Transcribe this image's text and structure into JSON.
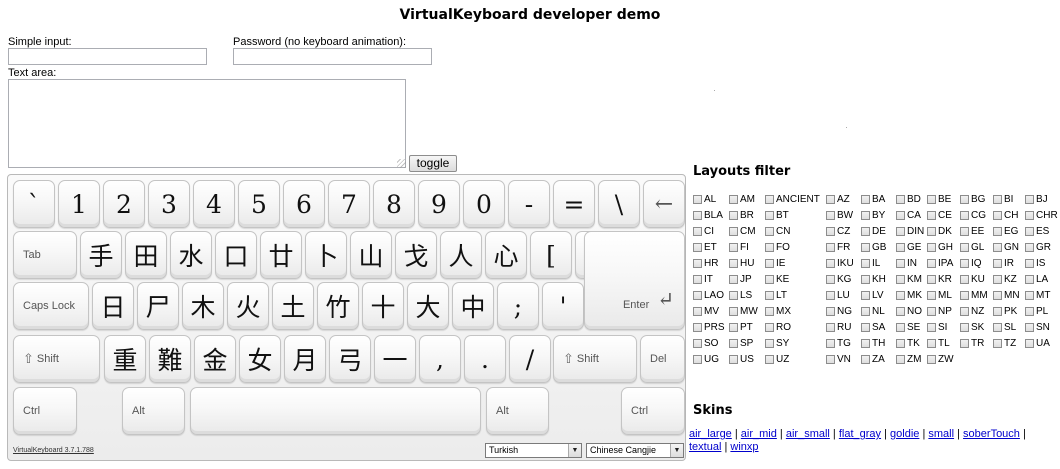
{
  "title": "VirtualKeyboard developer demo",
  "form": {
    "simple_label": "Simple input:",
    "simple_value": "",
    "password_label": "Password (no keyboard animation):",
    "password_value": "",
    "textarea_label": "Text area:",
    "textarea_value": "",
    "toggle_label": "toggle"
  },
  "keyboard": {
    "rows": [
      [
        "`",
        "1",
        "2",
        "3",
        "4",
        "5",
        "6",
        "7",
        "8",
        "9",
        "0",
        "-",
        "=",
        "\\",
        "←"
      ],
      [
        "Tab",
        "手",
        "田",
        "水",
        "口",
        "廿",
        "卜",
        "山",
        "戈",
        "人",
        "心",
        "[",
        "]"
      ],
      [
        "Caps Lock",
        "日",
        "尸",
        "木",
        "火",
        "土",
        "竹",
        "十",
        "大",
        "中",
        ";",
        "'",
        "Enter"
      ],
      [
        "Shift",
        "重",
        "難",
        "金",
        "女",
        "月",
        "弓",
        "一",
        ",",
        ".",
        "/",
        "Shift",
        "Del"
      ],
      [
        "Ctrl",
        "Alt",
        "",
        "Alt",
        "Ctrl"
      ]
    ],
    "version": "VirtualKeyboard 3.7.1.788",
    "layout_select": "Turkish",
    "variant_select": "Chinese Cangjie"
  },
  "layouts_filter": {
    "heading": "Layouts filter",
    "columns": [
      [
        "AL",
        "BLA",
        "CI",
        "ET",
        "HR",
        "IT",
        "LAO",
        "MV",
        "PRS",
        "SO",
        "UG"
      ],
      [
        "AM",
        "BR",
        "CM",
        "FI",
        "HU",
        "JP",
        "LS",
        "MW",
        "PT",
        "SP",
        "US"
      ],
      [
        "ANCIENT",
        "BT",
        "CN",
        "FO",
        "IE",
        "KE",
        "LT",
        "MX",
        "RO",
        "SY",
        "UZ"
      ],
      [
        "AZ",
        "BW",
        "CZ",
        "FR",
        "IKU",
        "KG",
        "LU",
        "NG",
        "RU",
        "TG",
        "VN"
      ],
      [
        "BA",
        "BY",
        "DE",
        "GB",
        "IL",
        "KH",
        "LV",
        "NL",
        "SA",
        "TH",
        "ZA"
      ],
      [
        "BD",
        "CA",
        "DIN",
        "GE",
        "IN",
        "KM",
        "MK",
        "NO",
        "SE",
        "TK",
        "ZM"
      ],
      [
        "BE",
        "CE",
        "DK",
        "GH",
        "IPA",
        "KR",
        "ML",
        "NP",
        "SI",
        "TL",
        "ZW"
      ],
      [
        "BG",
        "CG",
        "EE",
        "GL",
        "IQ",
        "KU",
        "MM",
        "NZ",
        "SK",
        "TR"
      ],
      [
        "BI",
        "CH",
        "EG",
        "GN",
        "IR",
        "KZ",
        "MN",
        "PK",
        "SL",
        "TZ"
      ],
      [
        "BJ",
        "CHR",
        "ES",
        "GR",
        "IS",
        "LA",
        "MT",
        "PL",
        "SN",
        "UA"
      ]
    ]
  },
  "skins": {
    "heading": "Skins",
    "items": [
      "air_large",
      "air_mid",
      "air_small",
      "flat_gray",
      "goldie",
      "small",
      "soberTouch",
      "textual",
      "winxp"
    ]
  }
}
